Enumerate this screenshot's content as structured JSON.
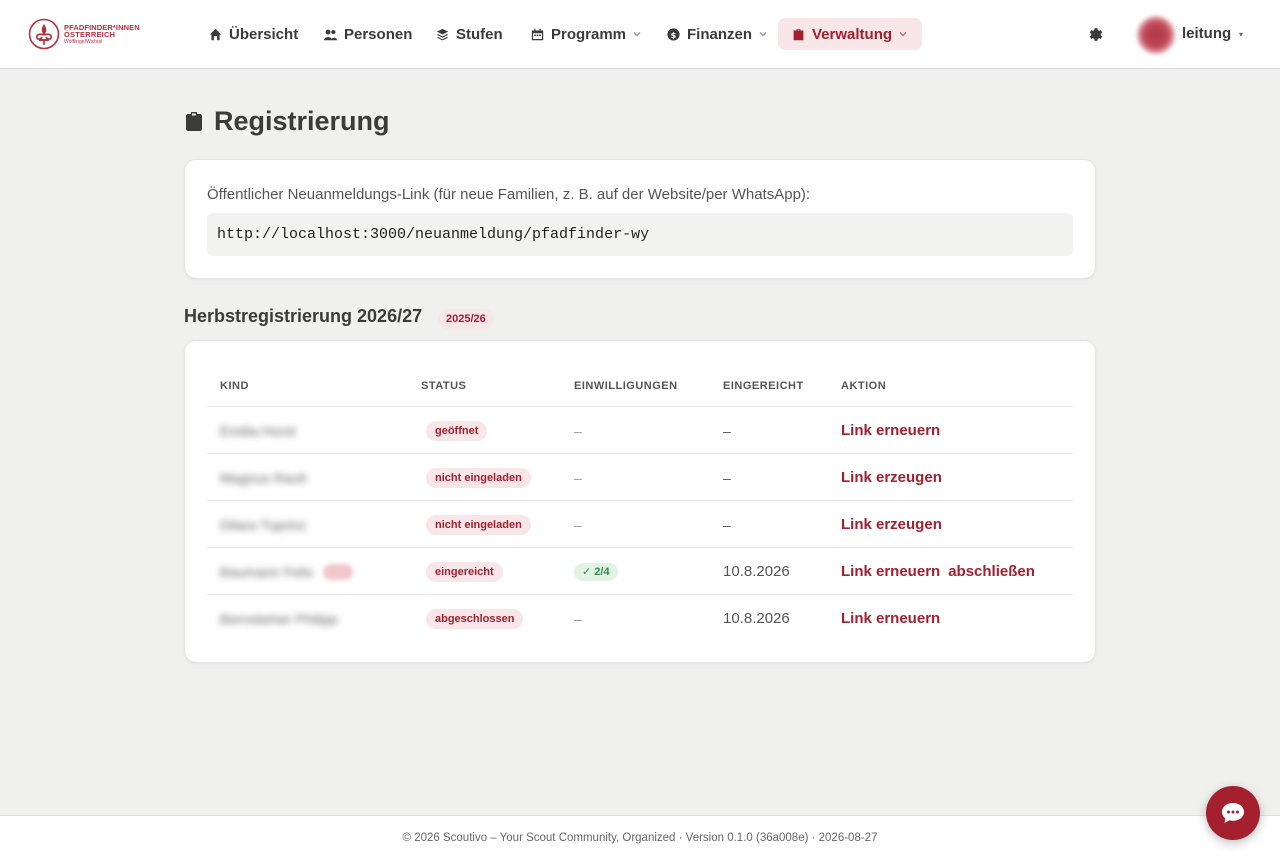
{
  "brand": {
    "line1": "PFADFINDER*INNEN",
    "line2": "ÖSTERREICH",
    "line3": "Wölflinge/Wichtel"
  },
  "nav": {
    "items": [
      {
        "label": "Übersicht",
        "icon": "home-icon"
      },
      {
        "label": "Personen",
        "icon": "users-icon"
      },
      {
        "label": "Stufen",
        "icon": "layers-icon"
      },
      {
        "label": "Programm",
        "icon": "calendar-icon",
        "dropdown": true
      },
      {
        "label": "Finanzen",
        "icon": "coin-icon",
        "dropdown": true
      },
      {
        "label": "Verwaltung",
        "icon": "briefcase-icon",
        "dropdown": true,
        "active": true
      }
    ],
    "user": {
      "name": "leitung",
      "caret": "▾"
    }
  },
  "page": {
    "title": "Registrierung",
    "public_link": {
      "label": "Öffentlicher Neuanmeldungs-Link (für neue Familien, z. B. auf der Website/per WhatsApp):",
      "url": "http://localhost:3000/neuanmeldung/pfadfinder-wy"
    },
    "section": {
      "title": "Herbstregistrierung 2026/27",
      "badge": "2025/26"
    },
    "table": {
      "headers": [
        "KIND",
        "STATUS",
        "EINWILLIGUNGEN",
        "EINGEREICHT",
        "AKTION"
      ],
      "rows": [
        {
          "kind": "Emilia Horst",
          "status": "geöffnet",
          "consents": "–",
          "submitted": "–",
          "actions": [
            "Link erneuern"
          ]
        },
        {
          "kind": "Magnus Rauh",
          "status": "nicht eingeladen",
          "consents": "–",
          "submitted": "–",
          "actions": [
            "Link erzeugen"
          ]
        },
        {
          "kind": "Dilara Tuprinz",
          "status": "nicht eingeladen",
          "consents": "–",
          "submitted": "–",
          "actions": [
            "Link erzeugen"
          ]
        },
        {
          "kind": "Baumann Felix",
          "status": "eingereicht",
          "consents": "✓ 2/4",
          "submitted": "10.8.2026",
          "actions": [
            "Link erneuern",
            "abschließen"
          ],
          "tag": true
        },
        {
          "kind": "Bernsteiner Philipp",
          "status": "abgeschlossen",
          "consents": "–",
          "submitted": "10.8.2026",
          "actions": [
            "Link erneuern"
          ]
        }
      ]
    }
  },
  "footer": {
    "text": "© 2026 Scoutivo – Your Scout Community, Organized · Version 0.1.0 (36a008e) · 2026-08-27"
  },
  "colors": {
    "accent": "#a3202f",
    "accent_bg": "#f8e6e8",
    "success": "#2e8b48",
    "success_bg": "#e2f3e6"
  }
}
